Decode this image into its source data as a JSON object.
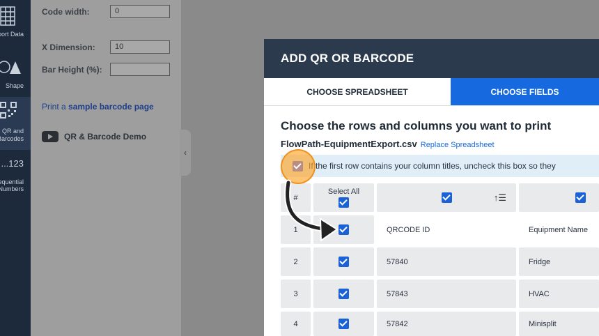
{
  "rail": {
    "items": [
      {
        "label": "Import Data",
        "icon": "grid-icon"
      },
      {
        "label": "Shape",
        "icon": "shape-icon"
      },
      {
        "label_line1": "QR and",
        "label_line2": "Barcodes",
        "icon": "qrcode-icon"
      },
      {
        "label_top": "123...",
        "label_line1": "Sequential",
        "label_line2": "Numbers"
      }
    ]
  },
  "panel": {
    "code_width_label": "Code width:",
    "code_width_value": "0",
    "x_dimension_label": "X Dimension:",
    "x_dimension_value": "10",
    "bar_height_label": "Bar Height (%):",
    "bar_height_value": "",
    "print_prefix": "Print a ",
    "sample_link": "sample barcode page",
    "demo_label": "QR & Barcode Demo"
  },
  "modal": {
    "title": "ADD QR OR BARCODE",
    "tabs": [
      {
        "label": "CHOOSE SPREADSHEET"
      },
      {
        "label": "CHOOSE FIELDS"
      }
    ],
    "heading": "Choose the rows and columns you want to print",
    "filename": "FlowPath-EquipmentExport.csv",
    "replace_link": "Replace Spreadsheet",
    "banner": "If the first row contains your column titles, uncheck this box so they",
    "table": {
      "col_hash": "#",
      "select_all": "Select All",
      "rows": [
        {
          "num": "1",
          "col1": "QRCODE ID",
          "col2": "Equipment Name"
        },
        {
          "num": "2",
          "col1": "57840",
          "col2": "Fridge"
        },
        {
          "num": "3",
          "col1": "57843",
          "col2": "HVAC"
        },
        {
          "num": "4",
          "col1": "57842",
          "col2": "Minisplit"
        }
      ]
    }
  },
  "colors": {
    "modal_header": "#2c3a4e",
    "active_tab": "#1769e0",
    "checkbox": "#1a62d6",
    "highlight": "#f5a228"
  }
}
